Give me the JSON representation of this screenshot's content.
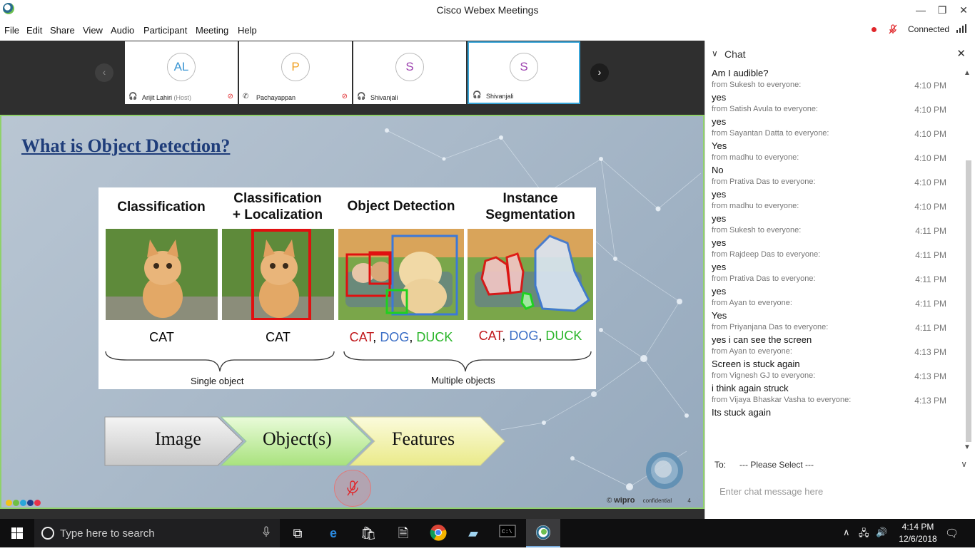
{
  "window": {
    "title": "Cisco Webex Meetings",
    "minimize": "—",
    "restore": "❐",
    "close": "✕"
  },
  "menu": [
    "File",
    "Edit",
    "Share",
    "View",
    "Audio",
    "Participant",
    "Meeting",
    "Help"
  ],
  "status": {
    "connected": "Connected"
  },
  "participants": [
    {
      "initials": "AL",
      "name": "Arijit Lahiri",
      "role": "(Host)",
      "color": "#3a95d3",
      "muted": true,
      "active": false
    },
    {
      "initials": "P",
      "name": "Pachayappan",
      "role": "",
      "color": "#f0a020",
      "muted": true,
      "active": false
    },
    {
      "initials": "S",
      "name": "Shivanjali",
      "role": "",
      "color": "#9b3fae",
      "muted": false,
      "active": false
    },
    {
      "initials": "S",
      "name": "Shivanjali",
      "role": "",
      "color": "#9b3fae",
      "muted": false,
      "active": true
    }
  ],
  "slide": {
    "title": "What is Object Detection?",
    "headers": {
      "classification": "Classification",
      "class_loc_1": "Classification",
      "class_loc_2": "+ Localization",
      "object_detection": "Object Detection",
      "instance_1": "Instance",
      "instance_2": "Segmentation"
    },
    "labels": {
      "cat1": "CAT",
      "cat2": "CAT",
      "det_cat": "CAT",
      "det_dog": "DOG",
      "det_duck": "DUCK",
      "seg_cat": "CAT",
      "seg_dog": "DOG",
      "seg_duck": "DUCK",
      "comma": ", "
    },
    "brace_single": "Single object",
    "brace_multiple": "Multiple objects",
    "flow": [
      "Image",
      "Object(s)",
      "Features"
    ],
    "footer_brand": "wipro",
    "footer_conf": "confidential",
    "footer_page": "4",
    "footer_copy": "©",
    "label_colors": {
      "cat": "#c0181c",
      "dog": "#3c6fc6",
      "duck": "#2ab52a"
    }
  },
  "chat": {
    "title": "Chat",
    "messages": [
      {
        "from": "",
        "time": "",
        "text": "Am I audible?"
      },
      {
        "from": "from Sukesh to everyone:",
        "time": "4:10 PM",
        "text": "yes"
      },
      {
        "from": "from Satish Avula to everyone:",
        "time": "4:10 PM",
        "text": "yes"
      },
      {
        "from": "from Sayantan Datta to everyone:",
        "time": "4:10 PM",
        "text": "Yes"
      },
      {
        "from": "from madhu to everyone:",
        "time": "4:10 PM",
        "text": "No"
      },
      {
        "from": "from Prativa Das to everyone:",
        "time": "4:10 PM",
        "text": "yes"
      },
      {
        "from": "from madhu to everyone:",
        "time": "4:10 PM",
        "text": "yes"
      },
      {
        "from": "from Sukesh to everyone:",
        "time": "4:11 PM",
        "text": "yes"
      },
      {
        "from": "from Rajdeep Das to everyone:",
        "time": "4:11 PM",
        "text": "yes"
      },
      {
        "from": "from Prativa Das to everyone:",
        "time": "4:11 PM",
        "text": "yes"
      },
      {
        "from": "from Ayan to everyone:",
        "time": "4:11 PM",
        "text": "Yes"
      },
      {
        "from": "from Priyanjana Das to everyone:",
        "time": "4:11 PM",
        "text": "yes i can see the screen"
      },
      {
        "from": "from Ayan to everyone:",
        "time": "4:13 PM",
        "text": "Screen is stuck again"
      },
      {
        "from": "from Vignesh GJ to everyone:",
        "time": "4:13 PM",
        "text": "i think again struck"
      },
      {
        "from": "from Vijaya Bhaskar Vasha to everyone:",
        "time": "4:13 PM",
        "text": "Its stuck again"
      }
    ],
    "to_label": "To:",
    "to_value": "--- Please Select ---",
    "input_placeholder": "Enter chat message here"
  },
  "taskbar": {
    "search_placeholder": "Type here to search",
    "time": "4:14 PM",
    "date": "12/6/2018"
  },
  "icons": {
    "app": "webex-icon",
    "start": "windows-start-icon",
    "search": "search-icon",
    "mic": "microphone-icon",
    "taskview": "task-view-icon",
    "edge": "edge-icon",
    "store": "store-icon",
    "files": "file-icon",
    "chrome": "chrome-icon",
    "notepad": "notepad-icon",
    "cmd": "cmd-icon",
    "webex": "webex-icon"
  }
}
